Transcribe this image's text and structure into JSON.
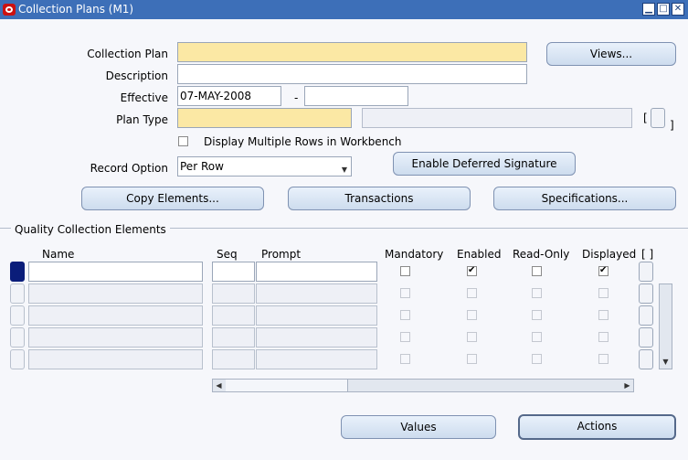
{
  "window": {
    "title": "Collection Plans (M1)"
  },
  "form": {
    "collection_plan_label": "Collection Plan",
    "collection_plan_value": "",
    "description_label": "Description",
    "description_value": "",
    "effective_label": "Effective",
    "effective_from": "07-MAY-2008",
    "effective_separator": "-",
    "effective_to": "",
    "plan_type_label": "Plan Type",
    "plan_type_value": "",
    "plan_type_desc": "",
    "display_multiple_label": "Display Multiple Rows in Workbench",
    "record_option_label": "Record Option",
    "record_option_value": "Per Row"
  },
  "buttons": {
    "views": "Views...",
    "enable_deferred": "Enable Deferred Signature",
    "copy_elements": "Copy Elements...",
    "transactions": "Transactions",
    "specifications": "Specifications...",
    "values": "Values",
    "actions": "Actions"
  },
  "elements": {
    "section_title": "Quality Collection Elements",
    "columns": {
      "name": "Name",
      "seq": "Seq",
      "prompt": "Prompt",
      "mandatory": "Mandatory",
      "enabled": "Enabled",
      "read_only": "Read-Only",
      "displayed": "Displayed",
      "folder": "[ ]"
    },
    "rows": [
      {
        "name": "",
        "seq": "",
        "prompt": "",
        "mandatory": false,
        "enabled": true,
        "read_only": false,
        "displayed": true,
        "active": true
      },
      {
        "name": "",
        "seq": "",
        "prompt": "",
        "mandatory": false,
        "enabled": false,
        "read_only": false,
        "displayed": false,
        "active": false
      },
      {
        "name": "",
        "seq": "",
        "prompt": "",
        "mandatory": false,
        "enabled": false,
        "read_only": false,
        "displayed": false,
        "active": false
      },
      {
        "name": "",
        "seq": "",
        "prompt": "",
        "mandatory": false,
        "enabled": false,
        "read_only": false,
        "displayed": false,
        "active": false
      },
      {
        "name": "",
        "seq": "",
        "prompt": "",
        "mandatory": false,
        "enabled": false,
        "read_only": false,
        "displayed": false,
        "active": false
      }
    ]
  },
  "icons": {
    "minimize": "minimize-icon",
    "maximize": "maximize-icon",
    "close": "close-icon",
    "dropdown": "chevron-down-icon"
  }
}
